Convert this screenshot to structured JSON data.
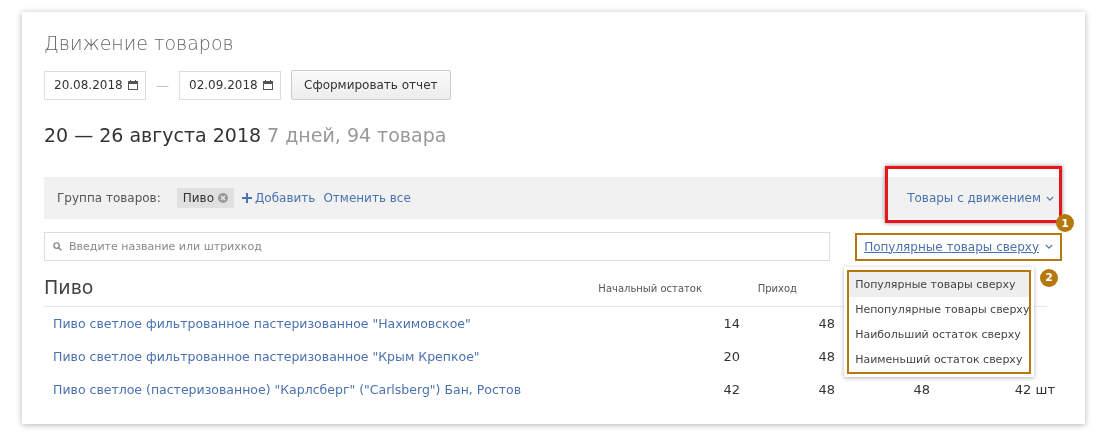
{
  "title": "Движение товаров",
  "date_from": "20.08.2018",
  "date_to": "02.09.2018",
  "date_separator": "—",
  "report_button": "Сформировать отчет",
  "period": {
    "range": "20 — 26 августа 2018",
    "summary": "7 дней, 94 товара"
  },
  "filter": {
    "label": "Группа товаров:",
    "tags": [
      "Пиво"
    ],
    "add_link": "Добавить",
    "clear_link": "Отменить все",
    "movement_dropdown": "Товары с движением"
  },
  "search": {
    "placeholder": "Введите название или штрихкод"
  },
  "sort": {
    "label": "Популярные товары сверху",
    "expanded": true,
    "options": [
      {
        "label": "Популярные товары сверху",
        "selected": true
      },
      {
        "label": "Непопулярные товары сверху",
        "selected": false
      },
      {
        "label": "Наибольший остаток сверху",
        "selected": false
      },
      {
        "label": "Наименьший остаток сверху",
        "selected": false
      }
    ]
  },
  "annotations": [
    "1",
    "2"
  ],
  "table": {
    "group": "Пиво",
    "columns": [
      "Начальный остаток",
      "Приход"
    ],
    "rows": [
      {
        "name": "Пиво светлое фильтрованное пастеризованное \"Нахимовское\"",
        "cells": [
          "14",
          "48"
        ]
      },
      {
        "name": "Пиво светлое фильтрованное пастеризованное \"Крым Крепкое\"",
        "cells": [
          "20",
          "48"
        ]
      },
      {
        "name": "Пиво светлое (пастеризованное) \"Карлсберг\" (\"Carlsberg\") Бан, Ростов",
        "cells": [
          "42",
          "48",
          "48",
          "42 шт"
        ]
      }
    ]
  }
}
